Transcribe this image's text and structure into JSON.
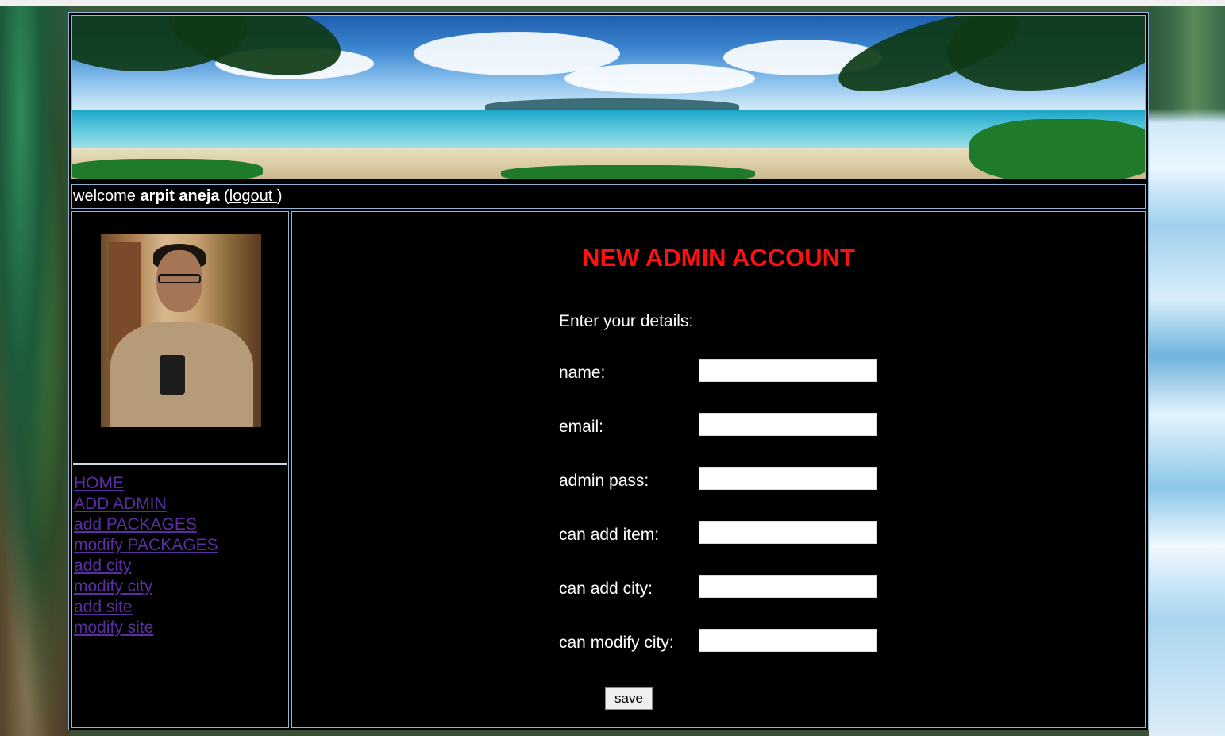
{
  "welcome": {
    "prefix": "welcome",
    "user": "arpit aneja",
    "open_paren": "(",
    "logout_label": "logout ",
    "close_paren": ")"
  },
  "sidebar": {
    "items": [
      {
        "label": "HOME"
      },
      {
        "label": "ADD ADMIN"
      },
      {
        "label": "add PACKAGES"
      },
      {
        "label": "modify PACKAGES"
      },
      {
        "label": "add city"
      },
      {
        "label": "modify city"
      },
      {
        "label": "add site"
      },
      {
        "label": "modify site"
      }
    ]
  },
  "main": {
    "title": "NEW ADMIN ACCOUNT",
    "intro": "Enter your details:",
    "fields": [
      {
        "label": "name:",
        "value": ""
      },
      {
        "label": "email:",
        "value": ""
      },
      {
        "label": "admin pass:",
        "value": ""
      },
      {
        "label": "can add item:",
        "value": ""
      },
      {
        "label": "can add city:",
        "value": ""
      },
      {
        "label": "can modify city:",
        "value": ""
      }
    ],
    "save_label": "save"
  },
  "colors": {
    "title": "#ff1010",
    "link": "#5a2ea0",
    "panel_bg": "#000000",
    "border": "#8fb6d9"
  }
}
